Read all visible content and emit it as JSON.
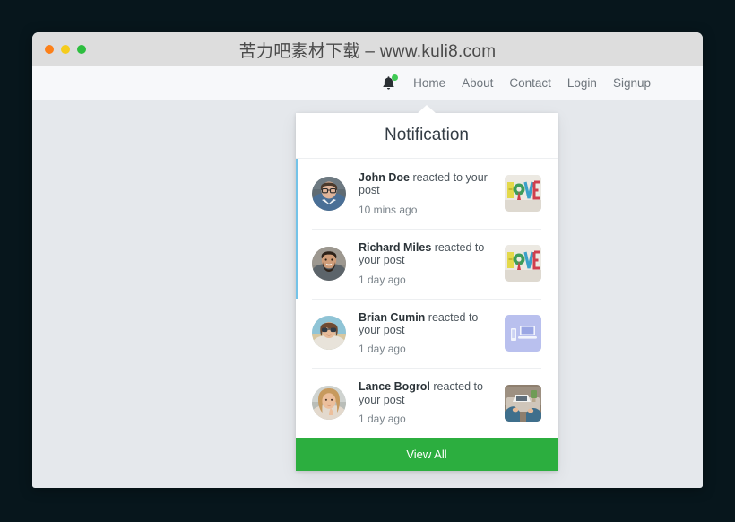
{
  "window": {
    "title": "苦力吧素材下载 – www.kuli8.com",
    "controls": [
      {
        "name": "close",
        "color": "#fc8019"
      },
      {
        "name": "minimize",
        "color": "#f5cc1c"
      },
      {
        "name": "maximize",
        "color": "#2dbe3f"
      }
    ]
  },
  "navbar": {
    "bell_icon": "bell-icon",
    "badge_color": "#3fca54",
    "links": [
      {
        "label": "Home"
      },
      {
        "label": "About"
      },
      {
        "label": "Contact"
      },
      {
        "label": "Login"
      },
      {
        "label": "Signup"
      }
    ]
  },
  "notification_panel": {
    "title": "Notification",
    "unread_indicator_color": "#74c3e8",
    "items": [
      {
        "user": "John Doe",
        "action": "reacted to your post",
        "time": "10 mins ago",
        "unread": true,
        "avatar": "avatar-man-glasses",
        "thumbnail": "thumb-home-letters"
      },
      {
        "user": "Richard Miles",
        "action": "reacted to your post",
        "time": "1 day ago",
        "unread": true,
        "avatar": "avatar-bearded-man",
        "thumbnail": "thumb-home-letters"
      },
      {
        "user": "Brian Cumin",
        "action": "reacted to your post",
        "time": "1 day ago",
        "unread": false,
        "avatar": "avatar-woman-sunglasses",
        "thumbnail": "thumb-devices"
      },
      {
        "user": "Lance Bogrol",
        "action": "reacted to your post",
        "time": "1 day ago",
        "unread": false,
        "avatar": "avatar-woman-blonde",
        "thumbnail": "thumb-desk-laptop"
      }
    ],
    "view_all_label": "View All",
    "view_all_color": "#2cae3f"
  }
}
